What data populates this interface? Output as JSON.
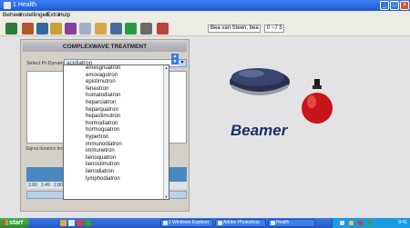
{
  "window": {
    "title": "1 Health"
  },
  "menu": [
    "Beheer",
    "Instellingen",
    "Extra",
    "Hulp"
  ],
  "toolbar": {
    "user_field": "Bea van Steen, bea",
    "small_field": "0 ~7  5"
  },
  "panel": {
    "header": "COMPLEXWAVE TREATMENT",
    "select_label": "Select Pr.Dynamic",
    "selected_value": "acidiatron",
    "text_label": "Signal duration time etc.",
    "scale_labels": [
      "2.00",
      "2.49",
      "2.80",
      "3"
    ],
    "progress": 0.0
  },
  "dropdown": {
    "items": [
      "emesgnuatron",
      "emovagotron",
      "epistimutron",
      "feneutron",
      "homatodiatron",
      "heparciatron",
      "heparquatron",
      "hepastimutron",
      "hormodiatron",
      "hormoquatron",
      "hypertron",
      "immunodiatron",
      "immunetron",
      "lienoquatron",
      "lienostimutron",
      "lienodiatron",
      "lymphodiatron"
    ]
  },
  "display": {
    "product_name": "Beamer",
    "colors": {
      "brand_text": "#1d2f66",
      "bulb": "#c8141c",
      "mouse": "#1c2440"
    }
  },
  "taskbar": {
    "start_label": "start",
    "tasks": [
      "2 Windows Explorer",
      "Adobe Photoshop",
      "Health"
    ],
    "clock": "9:41"
  }
}
